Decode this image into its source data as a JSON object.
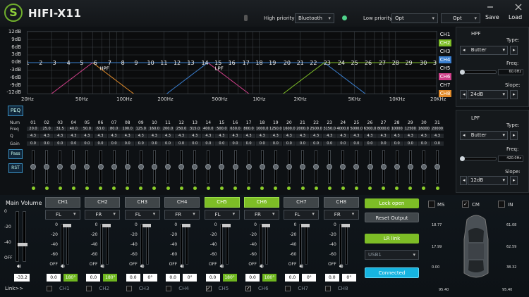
{
  "app": {
    "title": "HIFI-X11",
    "logo_letter": "S"
  },
  "header": {
    "high_priority_label": "High priority",
    "high_priority_value": "Bluetooth",
    "low_priority_label": "Low priority",
    "low_priority_value": "Opt",
    "preset_value": "Opt",
    "save_label": "Save",
    "load_label": "Load"
  },
  "eq": {
    "y_labels": [
      "12dB",
      "9dB",
      "6dB",
      "3dB",
      "0dB",
      "-3dB",
      "-6dB",
      "-9dB",
      "-12dB"
    ],
    "x_labels": [
      "20Hz",
      "50Hz",
      "100Hz",
      "200Hz",
      "500Hz",
      "1KHz",
      "2KHz",
      "5KHz",
      "10KHz",
      "20KHz"
    ],
    "point_labels": [
      "1",
      "2",
      "3",
      "4",
      "5",
      "6",
      "7",
      "8",
      "9",
      "10",
      "11",
      "12",
      "13",
      "14",
      "15",
      "16",
      "17",
      "18",
      "19",
      "20",
      "21",
      "22",
      "23",
      "24",
      "25",
      "26",
      "27",
      "28",
      "29",
      "30",
      "31"
    ],
    "hpf_label": "HPF",
    "lpf_label": "LPF",
    "channel_tags": [
      {
        "label": "CH1",
        "color": "#0e1114",
        "text": "#ffffff"
      },
      {
        "label": "CH2",
        "color": "#7dbd26",
        "text": "#ffffff"
      },
      {
        "label": "CH3",
        "color": "#0e1114",
        "text": "#ffffff"
      },
      {
        "label": "CH4",
        "color": "#3a7fd0",
        "text": "#ffffff"
      },
      {
        "label": "CH5",
        "color": "#0e1114",
        "text": "#ffffff"
      },
      {
        "label": "CH6",
        "color": "#d0408a",
        "text": "#ffffff"
      },
      {
        "label": "CH7",
        "color": "#0e1114",
        "text": "#ffffff"
      },
      {
        "label": "CH8",
        "color": "#e08a2a",
        "text": "#ffffff"
      }
    ]
  },
  "peq": {
    "peq_label": "PEQ",
    "pass_label": "Pass",
    "rst_label": "RST",
    "row_labels": {
      "num": "Num",
      "freq": "Freq",
      "q": "Q",
      "gain": "Gain"
    },
    "nums": [
      "01",
      "02",
      "03",
      "04",
      "05",
      "06",
      "07",
      "08",
      "09",
      "10",
      "11",
      "12",
      "13",
      "14",
      "15",
      "16",
      "17",
      "18",
      "19",
      "20",
      "21",
      "22",
      "23",
      "24",
      "25",
      "26",
      "27",
      "28",
      "29",
      "30",
      "31"
    ],
    "freqs": [
      "20.0",
      "25.0",
      "31.5",
      "40.0",
      "50.0",
      "63.0",
      "80.0",
      "100.0",
      "125.0",
      "160.0",
      "200.0",
      "250.0",
      "315.0",
      "400.0",
      "500.0",
      "630.0",
      "800.0",
      "1000.0",
      "1250.0",
      "1600.0",
      "2000.0",
      "2500.0",
      "3150.0",
      "4000.0",
      "5000.0",
      "6300.0",
      "8000.0",
      "10000",
      "12500",
      "16000",
      "20000"
    ],
    "qs": [
      "4.3",
      "4.3",
      "4.3",
      "4.3",
      "4.3",
      "4.3",
      "4.3",
      "4.3",
      "4.3",
      "4.3",
      "4.3",
      "4.3",
      "4.3",
      "4.3",
      "4.3",
      "4.3",
      "4.3",
      "4.3",
      "4.3",
      "4.3",
      "4.3",
      "4.3",
      "4.3",
      "4.3",
      "4.3",
      "4.3",
      "4.3",
      "4.3",
      "4.3",
      "4.3",
      "4.3"
    ],
    "gains": [
      "0.0",
      "0.0",
      "0.0",
      "0.0",
      "0.0",
      "0.0",
      "0.0",
      "0.0",
      "0.0",
      "0.0",
      "0.0",
      "0.0",
      "0.0",
      "0.0",
      "0.0",
      "0.0",
      "0.0",
      "0.0",
      "0.0",
      "0.0",
      "0.0",
      "0.0",
      "0.0",
      "0.0",
      "0.0",
      "0.0",
      "0.0",
      "0.0",
      "0.0",
      "0.0",
      "0.0"
    ]
  },
  "hpf": {
    "title": "HPF",
    "type_label": "Type:",
    "type_value": "Butter",
    "freq_label": "Freq:",
    "freq_value": "60.0Hz",
    "freq_fraction": 0.0,
    "slope_label": "Slope:",
    "slope_value": "24dB"
  },
  "lpf": {
    "title": "LPF",
    "type_label": "Type:",
    "type_value": "Butter",
    "freq_label": "Freq:",
    "freq_value": "420.0Hz",
    "freq_fraction": 0.0,
    "slope_label": "Slope:",
    "slope_value": "12dB"
  },
  "main_volume": {
    "label": "Main Volume",
    "scale": [
      "0",
      "-20",
      "-40",
      "OFF"
    ],
    "value": "-33.2"
  },
  "channels": [
    {
      "label": "CH1",
      "output": "FL",
      "active": false,
      "delay": "0.0",
      "phase": "180°",
      "phase_on": true,
      "link": "CH1",
      "linked": false
    },
    {
      "label": "CH2",
      "output": "FR",
      "active": false,
      "delay": "0.0",
      "phase": "180°",
      "phase_on": true,
      "link": "CH2",
      "linked": false
    },
    {
      "label": "CH3",
      "output": "FL",
      "active": false,
      "delay": "0.0",
      "phase": "0°",
      "phase_on": false,
      "link": "CH3",
      "linked": false
    },
    {
      "label": "CH4",
      "output": "FR",
      "active": false,
      "delay": "0.0",
      "phase": "0°",
      "phase_on": false,
      "link": "CH4",
      "linked": false
    },
    {
      "label": "CH5",
      "output": "FL",
      "active": true,
      "delay": "0.0",
      "phase": "180°",
      "phase_on": true,
      "link": "CH5",
      "linked": true
    },
    {
      "label": "CH6",
      "output": "FR",
      "active": true,
      "delay": "0.0",
      "phase": "180°",
      "phase_on": true,
      "link": "CH6",
      "linked": true
    },
    {
      "label": "CH7",
      "output": "FL",
      "active": false,
      "delay": "0.0",
      "phase": "0°",
      "phase_on": false,
      "link": "CH7",
      "linked": false
    },
    {
      "label": "CH8",
      "output": "FR",
      "active": false,
      "delay": "0.0",
      "phase": "0°",
      "phase_on": false,
      "link": "CH8",
      "linked": false
    }
  ],
  "fader_scale": [
    "0",
    "-20",
    "-40",
    "-60",
    "OFF"
  ],
  "controls": {
    "lock_label": "Lock open",
    "reset_label": "Reset Output",
    "lr_link_label": "LR link",
    "usb_value": "USB1",
    "connected_label": "Connected",
    "link_label": "Link>>"
  },
  "mode": {
    "ms_label": "MS",
    "cm_label": "CM",
    "in_label": "IN",
    "cm_checked": true
  },
  "car": {
    "values": [
      "18.77",
      "61.08",
      "17.99",
      "62.59",
      "0.00",
      "38.32",
      "95.40",
      "95.40"
    ]
  }
}
